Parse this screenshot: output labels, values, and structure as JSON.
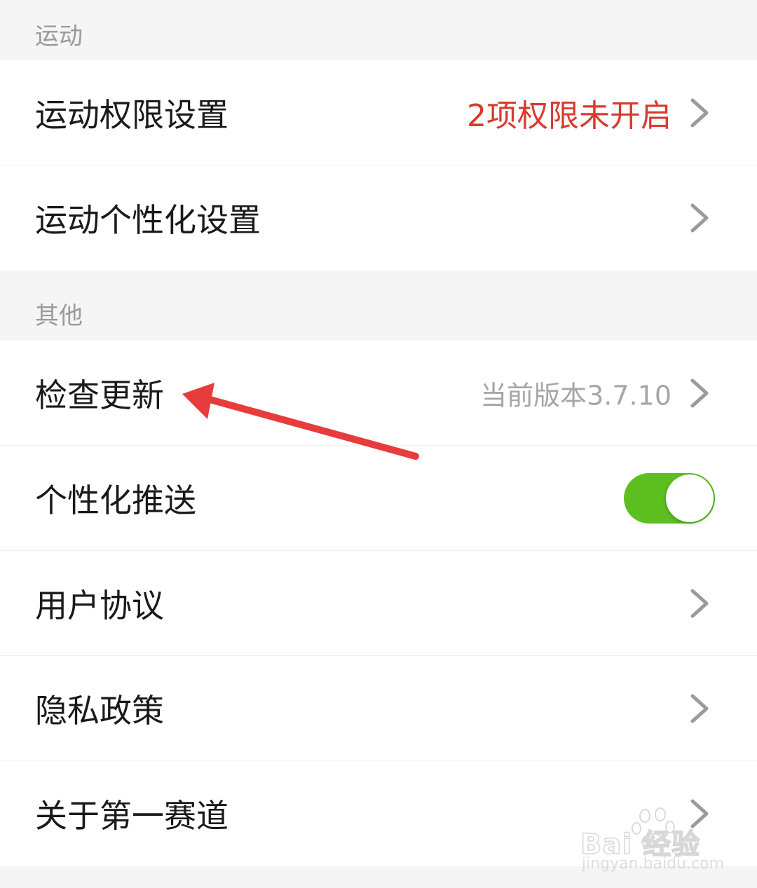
{
  "colors": {
    "alert": "#d83a2e",
    "toggle_on": "#5cbf1f",
    "annotation_arrow": "#e83b3b",
    "chevron": "#9b9b9b"
  },
  "sections": {
    "sport": {
      "title": "运动",
      "items": [
        {
          "label": "运动权限设置",
          "value": "2项权限未开启",
          "icon": "chevron-right-icon"
        },
        {
          "label": "运动个性化设置",
          "icon": "chevron-right-icon"
        }
      ]
    },
    "other": {
      "title": "其他",
      "items": [
        {
          "label": "检查更新",
          "value": "当前版本3.7.10",
          "icon": "chevron-right-icon"
        },
        {
          "label": "个性化推送",
          "toggle": "on"
        },
        {
          "label": "用户协议",
          "icon": "chevron-right-icon"
        },
        {
          "label": "隐私政策",
          "icon": "chevron-right-icon"
        },
        {
          "label": "关于第一赛道",
          "icon": "chevron-right-icon"
        }
      ]
    }
  },
  "watermark": {
    "logo_text": "Bai  经验",
    "url": "jingyan.baidu.com"
  }
}
